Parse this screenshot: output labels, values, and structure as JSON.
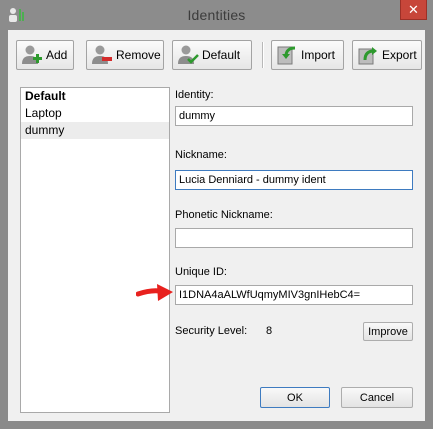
{
  "window": {
    "title": "Identities",
    "close_glyph": "✕"
  },
  "toolbar": {
    "buttons": [
      {
        "label": "Add",
        "icon": "user-add-icon"
      },
      {
        "label": "Remove",
        "icon": "user-remove-icon"
      },
      {
        "label": "Default",
        "icon": "user-default-icon"
      },
      {
        "label": "Import",
        "icon": "import-icon"
      },
      {
        "label": "Export",
        "icon": "export-icon"
      }
    ]
  },
  "identity_list": {
    "items": [
      {
        "label": "Default",
        "bold": true,
        "selected": false
      },
      {
        "label": "Laptop",
        "bold": false,
        "selected": false
      },
      {
        "label": "dummy",
        "bold": false,
        "selected": true
      }
    ]
  },
  "form": {
    "identity": {
      "label": "Identity:",
      "value": "dummy"
    },
    "nickname": {
      "label": "Nickname:",
      "value": "Lucia Denniard - dummy ident"
    },
    "phonetic_nickname": {
      "label": "Phonetic Nickname:",
      "value": ""
    },
    "unique_id": {
      "label": "Unique ID:",
      "value": "I1DNA4aALWfUqmyMIV3gnIHebC4="
    },
    "security_level": {
      "label": "Security Level:",
      "value": "8",
      "improve_label": "Improve"
    }
  },
  "footer": {
    "ok_label": "OK",
    "cancel_label": "Cancel"
  },
  "colors": {
    "annotation_arrow": "#e8211e",
    "titlebar": "#8c8c8c",
    "close": "#c7463a"
  }
}
